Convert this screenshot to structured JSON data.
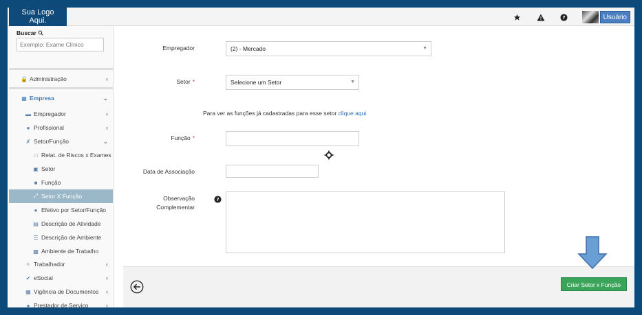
{
  "app": {
    "logo_line1": "Sua Logo",
    "logo_line2": "Aqui.",
    "user_label": "Usuário"
  },
  "icons": {
    "star": "star-icon",
    "warning": "warning-icon",
    "help": "help-icon",
    "avatar": "user-avatar"
  },
  "sidebar": {
    "search_label": "Buscar",
    "search_placeholder": "Exemplo: Exame Clínico",
    "items": [
      {
        "label": "Administração"
      },
      {
        "label": "Empresa"
      },
      {
        "label": "Empregador"
      },
      {
        "label": "Profissional"
      },
      {
        "label": "Setor/Função"
      },
      {
        "label": "Relat. de Riscos x Exames"
      },
      {
        "label": "Setor"
      },
      {
        "label": "Função"
      },
      {
        "label": "Setor X Função"
      },
      {
        "label": "Efetivo por Setor/Função"
      },
      {
        "label": "Descrição de Atividade"
      },
      {
        "label": "Descrição de Ambiente"
      },
      {
        "label": "Ambiente de Trabalho"
      },
      {
        "label": "Trabalhador"
      },
      {
        "label": "eSocial"
      },
      {
        "label": "Vigência de Documentos"
      },
      {
        "label": "Prestador de Serviço"
      }
    ]
  },
  "form": {
    "empregador_label": "Empregador",
    "empregador_value": "(2) - Mercado",
    "setor_label": "Setor",
    "setor_value": "Selecione um Setor",
    "hint_text": "Para ver as funções já cadastradas para esse setor",
    "hint_link": "clique aqui",
    "funcao_label": "Função",
    "funcao_value": "",
    "data_label": "Data de Associação",
    "data_value": "",
    "obs_label_line1": "Observação",
    "obs_label_line2": "Complementar",
    "obs_value": "",
    "required_mark": "*"
  },
  "footer": {
    "create_label": "Criar Setor x Função"
  },
  "colors": {
    "brand": "#0f4a7b",
    "accent": "#3c7ab4",
    "active_row": "#9bb8c8",
    "create_button": "#3aa55a",
    "annotation_arrow": "#6a9fd6"
  }
}
